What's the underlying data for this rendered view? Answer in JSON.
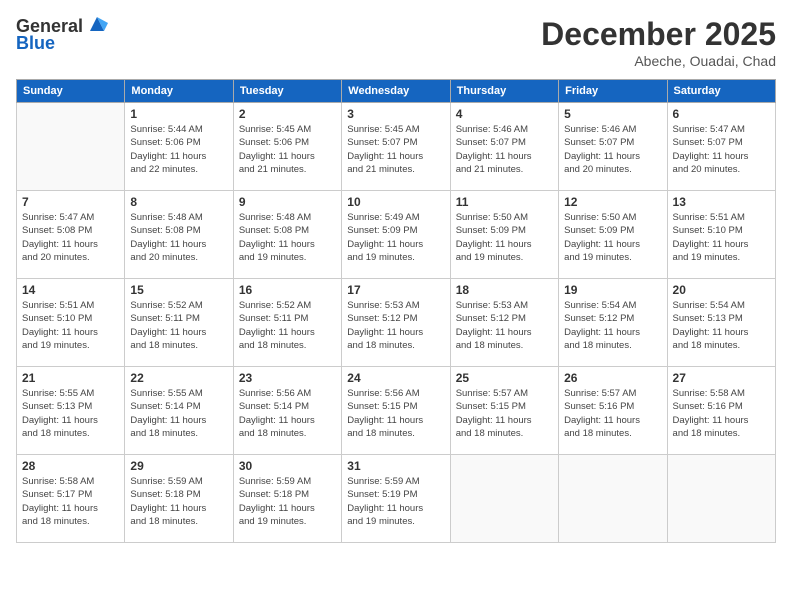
{
  "header": {
    "logo_line1": "General",
    "logo_line2": "Blue",
    "month": "December 2025",
    "location": "Abeche, Ouadai, Chad"
  },
  "weekdays": [
    "Sunday",
    "Monday",
    "Tuesday",
    "Wednesday",
    "Thursday",
    "Friday",
    "Saturday"
  ],
  "weeks": [
    [
      {
        "day": "",
        "info": ""
      },
      {
        "day": "1",
        "info": "Sunrise: 5:44 AM\nSunset: 5:06 PM\nDaylight: 11 hours\nand 22 minutes."
      },
      {
        "day": "2",
        "info": "Sunrise: 5:45 AM\nSunset: 5:06 PM\nDaylight: 11 hours\nand 21 minutes."
      },
      {
        "day": "3",
        "info": "Sunrise: 5:45 AM\nSunset: 5:07 PM\nDaylight: 11 hours\nand 21 minutes."
      },
      {
        "day": "4",
        "info": "Sunrise: 5:46 AM\nSunset: 5:07 PM\nDaylight: 11 hours\nand 21 minutes."
      },
      {
        "day": "5",
        "info": "Sunrise: 5:46 AM\nSunset: 5:07 PM\nDaylight: 11 hours\nand 20 minutes."
      },
      {
        "day": "6",
        "info": "Sunrise: 5:47 AM\nSunset: 5:07 PM\nDaylight: 11 hours\nand 20 minutes."
      }
    ],
    [
      {
        "day": "7",
        "info": "Sunrise: 5:47 AM\nSunset: 5:08 PM\nDaylight: 11 hours\nand 20 minutes."
      },
      {
        "day": "8",
        "info": "Sunrise: 5:48 AM\nSunset: 5:08 PM\nDaylight: 11 hours\nand 20 minutes."
      },
      {
        "day": "9",
        "info": "Sunrise: 5:48 AM\nSunset: 5:08 PM\nDaylight: 11 hours\nand 19 minutes."
      },
      {
        "day": "10",
        "info": "Sunrise: 5:49 AM\nSunset: 5:09 PM\nDaylight: 11 hours\nand 19 minutes."
      },
      {
        "day": "11",
        "info": "Sunrise: 5:50 AM\nSunset: 5:09 PM\nDaylight: 11 hours\nand 19 minutes."
      },
      {
        "day": "12",
        "info": "Sunrise: 5:50 AM\nSunset: 5:09 PM\nDaylight: 11 hours\nand 19 minutes."
      },
      {
        "day": "13",
        "info": "Sunrise: 5:51 AM\nSunset: 5:10 PM\nDaylight: 11 hours\nand 19 minutes."
      }
    ],
    [
      {
        "day": "14",
        "info": "Sunrise: 5:51 AM\nSunset: 5:10 PM\nDaylight: 11 hours\nand 19 minutes."
      },
      {
        "day": "15",
        "info": "Sunrise: 5:52 AM\nSunset: 5:11 PM\nDaylight: 11 hours\nand 18 minutes."
      },
      {
        "day": "16",
        "info": "Sunrise: 5:52 AM\nSunset: 5:11 PM\nDaylight: 11 hours\nand 18 minutes."
      },
      {
        "day": "17",
        "info": "Sunrise: 5:53 AM\nSunset: 5:12 PM\nDaylight: 11 hours\nand 18 minutes."
      },
      {
        "day": "18",
        "info": "Sunrise: 5:53 AM\nSunset: 5:12 PM\nDaylight: 11 hours\nand 18 minutes."
      },
      {
        "day": "19",
        "info": "Sunrise: 5:54 AM\nSunset: 5:12 PM\nDaylight: 11 hours\nand 18 minutes."
      },
      {
        "day": "20",
        "info": "Sunrise: 5:54 AM\nSunset: 5:13 PM\nDaylight: 11 hours\nand 18 minutes."
      }
    ],
    [
      {
        "day": "21",
        "info": "Sunrise: 5:55 AM\nSunset: 5:13 PM\nDaylight: 11 hours\nand 18 minutes."
      },
      {
        "day": "22",
        "info": "Sunrise: 5:55 AM\nSunset: 5:14 PM\nDaylight: 11 hours\nand 18 minutes."
      },
      {
        "day": "23",
        "info": "Sunrise: 5:56 AM\nSunset: 5:14 PM\nDaylight: 11 hours\nand 18 minutes."
      },
      {
        "day": "24",
        "info": "Sunrise: 5:56 AM\nSunset: 5:15 PM\nDaylight: 11 hours\nand 18 minutes."
      },
      {
        "day": "25",
        "info": "Sunrise: 5:57 AM\nSunset: 5:15 PM\nDaylight: 11 hours\nand 18 minutes."
      },
      {
        "day": "26",
        "info": "Sunrise: 5:57 AM\nSunset: 5:16 PM\nDaylight: 11 hours\nand 18 minutes."
      },
      {
        "day": "27",
        "info": "Sunrise: 5:58 AM\nSunset: 5:16 PM\nDaylight: 11 hours\nand 18 minutes."
      }
    ],
    [
      {
        "day": "28",
        "info": "Sunrise: 5:58 AM\nSunset: 5:17 PM\nDaylight: 11 hours\nand 18 minutes."
      },
      {
        "day": "29",
        "info": "Sunrise: 5:59 AM\nSunset: 5:18 PM\nDaylight: 11 hours\nand 18 minutes."
      },
      {
        "day": "30",
        "info": "Sunrise: 5:59 AM\nSunset: 5:18 PM\nDaylight: 11 hours\nand 19 minutes."
      },
      {
        "day": "31",
        "info": "Sunrise: 5:59 AM\nSunset: 5:19 PM\nDaylight: 11 hours\nand 19 minutes."
      },
      {
        "day": "",
        "info": ""
      },
      {
        "day": "",
        "info": ""
      },
      {
        "day": "",
        "info": ""
      }
    ]
  ]
}
